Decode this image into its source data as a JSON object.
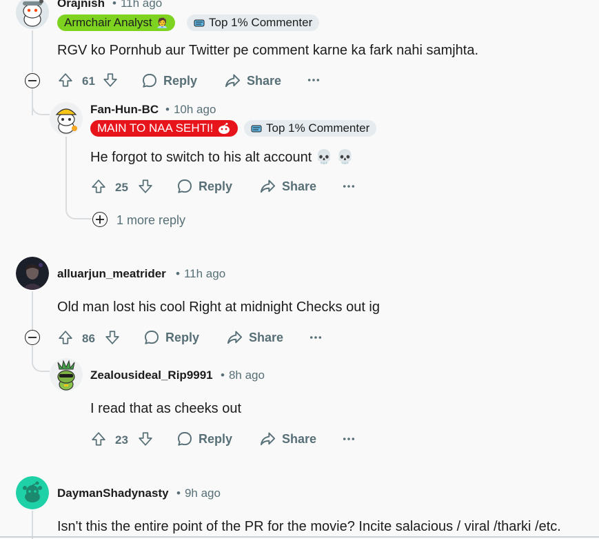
{
  "comments": [
    {
      "username": "Orajnish",
      "time": "11h ago",
      "flairs": [
        "Armchair Analyst",
        "Top 1% Commenter"
      ],
      "body": "RGV ko Pornhub aur Twitter pe comment karne ka fark nahi samjhta.",
      "votes": "61",
      "reply": "Reply",
      "share": "Share",
      "replies": [
        {
          "username": "Fan-Hun-BC",
          "time": "10h ago",
          "flairs": [
            "MAIN TO NAA SEHTI!",
            "Top 1% Commenter"
          ],
          "body": "He forgot to switch to his alt account 💀 💀",
          "votes": "25",
          "reply": "Reply",
          "share": "Share",
          "more_replies": "1 more reply"
        }
      ]
    },
    {
      "username": "alluarjun_meatrider",
      "time": "11h ago",
      "body": "Old man lost his cool Right at midnight Checks out ig",
      "votes": "86",
      "reply": "Reply",
      "share": "Share",
      "replies": [
        {
          "username": "Zealousideal_Rip9991",
          "time": "8h ago",
          "body": "I read that as cheeks out",
          "votes": "23",
          "reply": "Reply",
          "share": "Share"
        }
      ]
    },
    {
      "username": "DaymanShadynasty",
      "time": "9h ago",
      "body": "Isn't this the entire point of the PR for the movie? Incite salacious / viral /tharki /etc."
    }
  ],
  "colors": {
    "flair_green": "#7ed321",
    "flair_red": "#e8141c",
    "flair_gray": "#e5ebee",
    "meta_text": "#576f76",
    "background": "#f9f9f9"
  },
  "icons": [
    "upvote-icon",
    "downvote-icon",
    "reply-icon",
    "share-icon",
    "more-options-icon",
    "collapse-minus-icon",
    "expand-plus-icon",
    "snoo-avatar-icon"
  ]
}
